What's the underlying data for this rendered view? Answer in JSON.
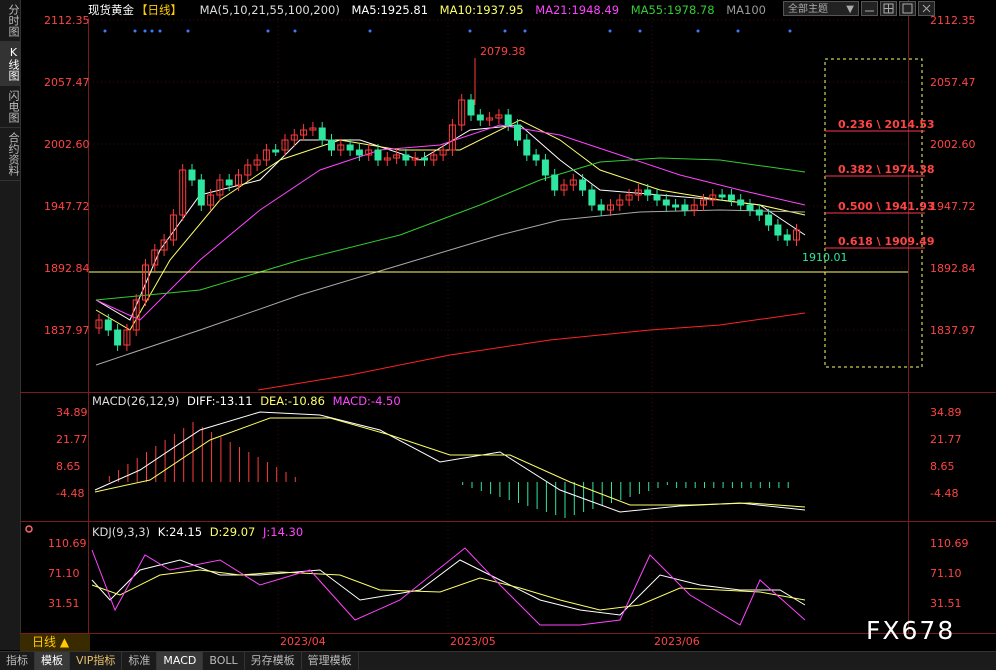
{
  "sidebar": {
    "tabs": [
      "分时图",
      "K线图",
      "闪电图",
      "合约资料"
    ],
    "active": 1
  },
  "header": {
    "instrument": "现货黄金",
    "period_tag": "【日线】",
    "ma_formula": "MA(5,10,21,55,100,200)",
    "ma5": "MA5:1925.81",
    "ma10": "MA10:1937.95",
    "ma21": "MA21:1948.49",
    "ma55": "MA55:1978.78",
    "ma100": "MA100"
  },
  "top_buttons": {
    "theme": "全部主题",
    "theme_arrow": "▼"
  },
  "price_axis": [
    "2112.35",
    "2057.47",
    "2002.60",
    "1947.72",
    "1892.84",
    "1837.97"
  ],
  "macd_axis": [
    "34.89",
    "21.77",
    "8.65",
    "-4.48"
  ],
  "kdj_axis": [
    "110.69",
    "71.10",
    "31.51"
  ],
  "annotations": {
    "high": "2079.38",
    "low": "1910.01"
  },
  "fib_levels": [
    {
      "label": "0.236 \\ 2014.53"
    },
    {
      "label": "0.382 \\ 1974.38"
    },
    {
      "label": "0.500 \\ 1941.93"
    },
    {
      "label": "0.618 \\ 1909.49"
    }
  ],
  "macd": {
    "name": "MACD(26,12,9)",
    "diff": "DIFF:-13.11",
    "dea": "DEA:-10.86",
    "macd": "MACD:-4.50"
  },
  "kdj": {
    "name": "KDJ(9,3,3)",
    "k": "K:24.15",
    "d": "D:29.07",
    "j": "J:14.30"
  },
  "date_axis": [
    "2023/04",
    "2023/05",
    "2023/06"
  ],
  "timeframe": "日线 ▲",
  "bottom_tabs": [
    "指标",
    "模板",
    "VIP指标",
    "标准",
    "MACD",
    "BOLL",
    "另存模板",
    "管理模板"
  ],
  "watermark": "FX678",
  "colors": {
    "up": "#ff3b3b",
    "down": "#2ee6a0",
    "ma5": "#ffffff",
    "ma10": "#ffff66",
    "ma21": "#ff44ff",
    "ma55": "#33cc33",
    "ma100": "#aaaaaa",
    "ma200": "#ff2222",
    "fib": "#ff3355",
    "support": "#ffff66"
  }
}
